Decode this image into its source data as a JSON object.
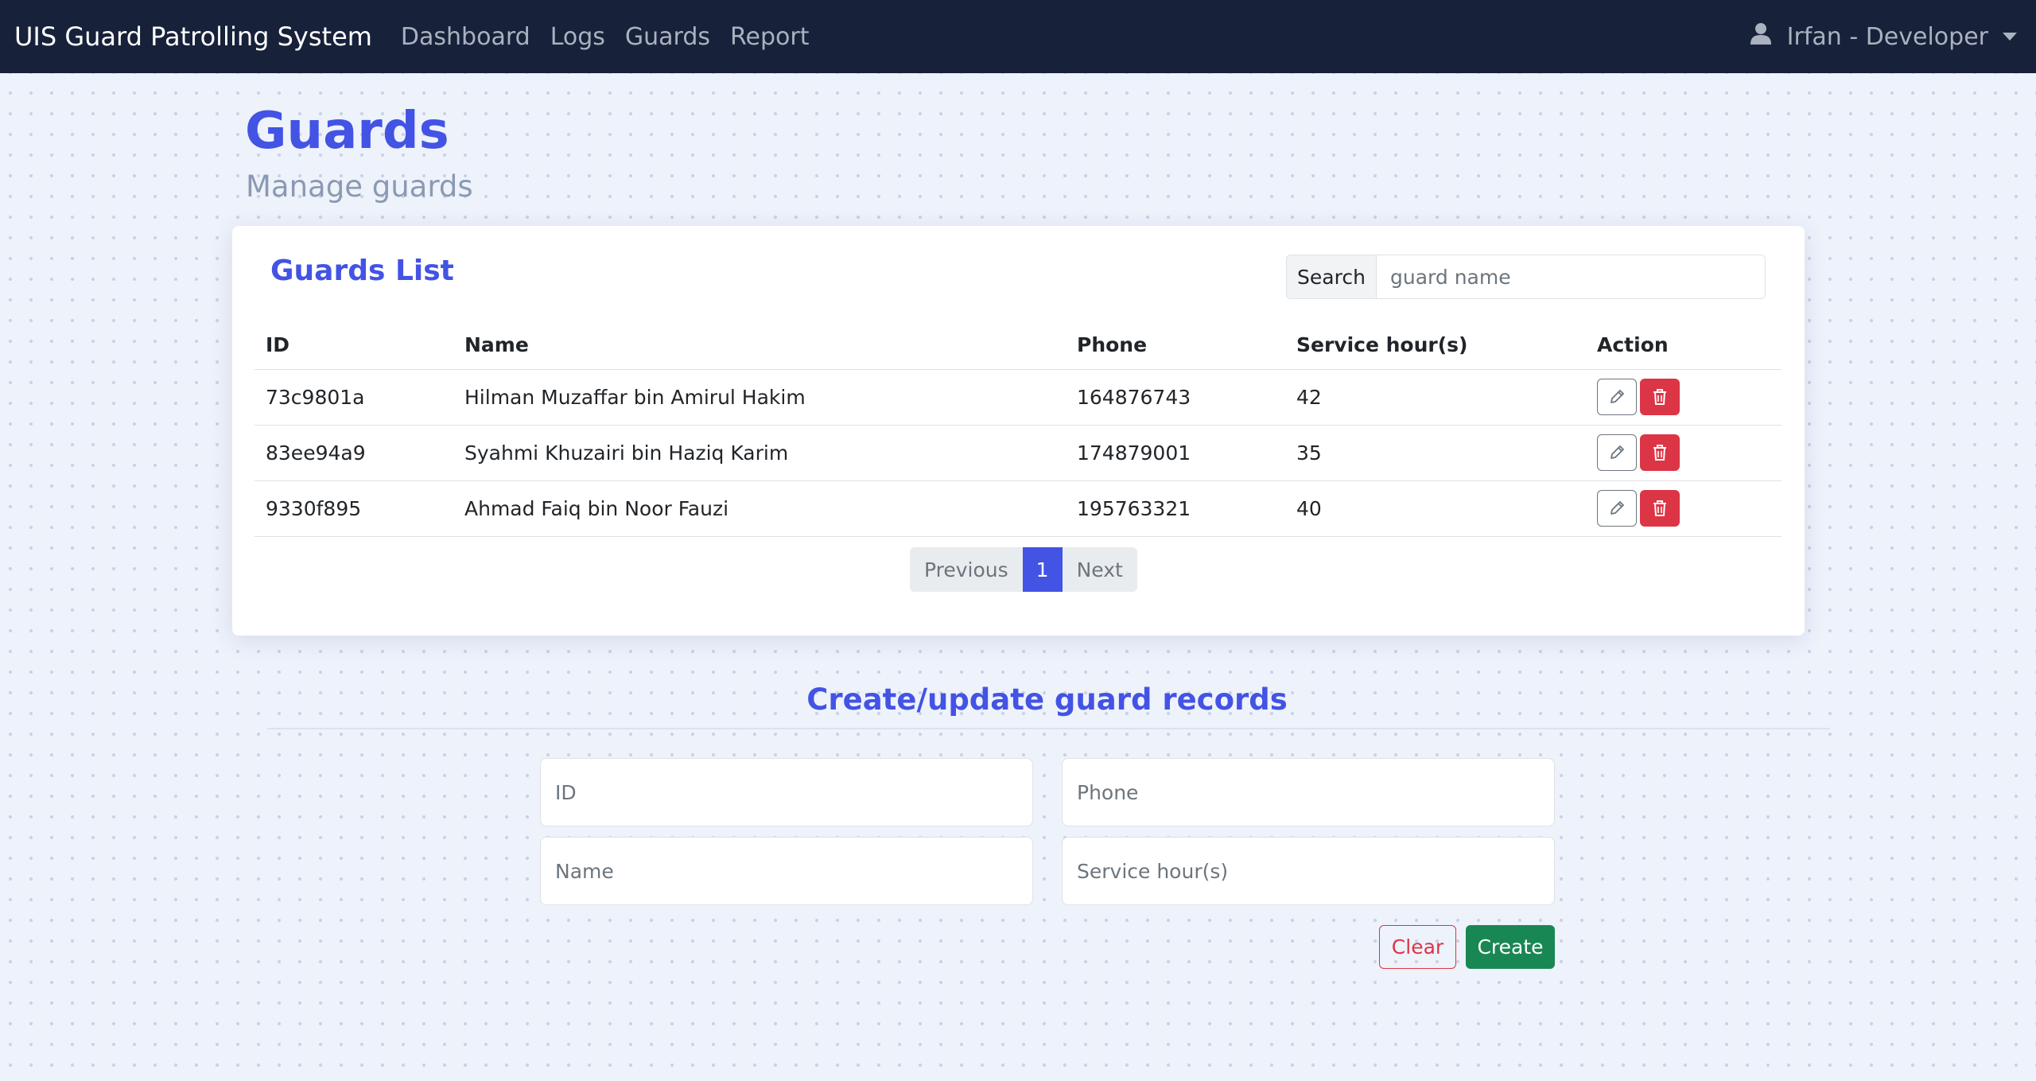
{
  "navbar": {
    "brand": "UIS Guard Patrolling System",
    "links": [
      "Dashboard",
      "Logs",
      "Guards",
      "Report"
    ],
    "user": "Irfan - Developer"
  },
  "header": {
    "title": "Guards",
    "subtitle": "Manage guards"
  },
  "guards_card": {
    "title": "Guards List",
    "search_label": "Search",
    "search_placeholder": "guard name",
    "columns": [
      "ID",
      "Name",
      "Phone",
      "Service hour(s)",
      "Action"
    ],
    "rows": [
      {
        "id": "73c9801a",
        "name": "Hilman Muzaffar bin Amirul Hakim",
        "phone": "164876743",
        "hours": "42"
      },
      {
        "id": "83ee94a9",
        "name": "Syahmi Khuzairi bin Haziq Karim",
        "phone": "174879001",
        "hours": "35"
      },
      {
        "id": "9330f895",
        "name": "Ahmad Faiq bin Noor Fauzi",
        "phone": "195763321",
        "hours": "40"
      }
    ],
    "pagination": {
      "previous": "Previous",
      "current": "1",
      "next": "Next"
    }
  },
  "form": {
    "title": "Create/update guard records",
    "id_placeholder": "ID",
    "phone_placeholder": "Phone",
    "name_placeholder": "Name",
    "hours_placeholder": "Service hour(s)",
    "clear_label": "Clear",
    "create_label": "Create"
  },
  "colors": {
    "navbar": "#17213a",
    "accent": "#4353e4",
    "danger": "#dc3545",
    "success": "#198754"
  },
  "icons": {
    "user": "user-icon",
    "dropdown": "caret-down-icon",
    "edit": "pencil-icon",
    "delete": "trash-icon"
  }
}
